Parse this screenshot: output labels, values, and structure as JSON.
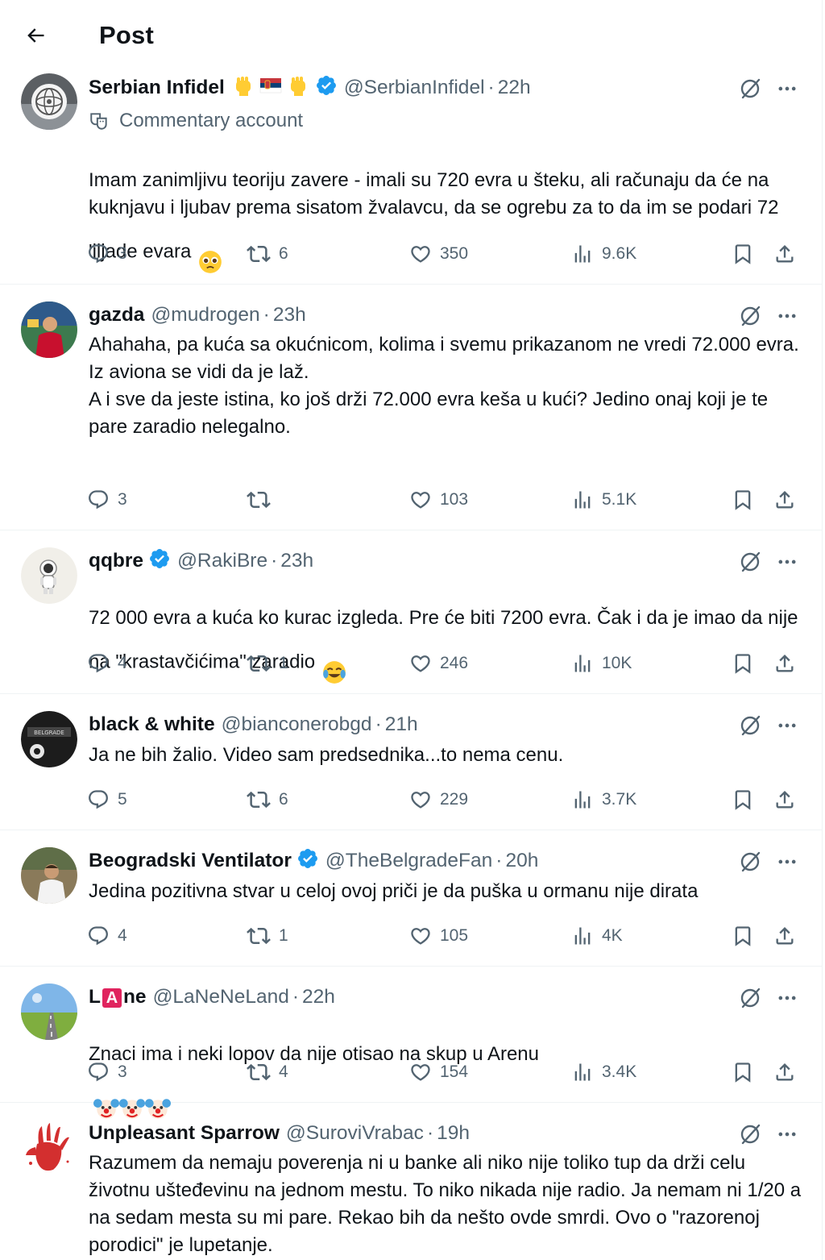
{
  "header": {
    "title": "Post"
  },
  "main": {
    "community_label": "Commentary account",
    "posts": [
      {
        "name": "Serbian Infidel",
        "handle": "@SerbianInfidel",
        "time": "22h",
        "verified": true,
        "name_emojis": [
          "raised-fist-icon",
          "serbia-flag-icon",
          "raised-fist-icon"
        ],
        "text": "Imam zanimljivu teoriju zavere - imali su 720 evra u šteku, ali računaju da će na kuknjavu i ljubav prema sisatom žvalavcu, da se ogrebu za to da im se podari 72 'iljade evara",
        "replies": "3",
        "reposts": "6",
        "likes": "350",
        "views": "9.6K"
      },
      {
        "name": "gazda",
        "handle": "@mudrogen",
        "time": "23h",
        "verified": false,
        "text": "Ahahaha, pa kuća sa okućnicom, kolima i svemu prikazanom ne vredi 72.000 evra.\nIz aviona se vidi da je laž.\nA i sve da jeste istina, ko još drži 72.000 evra keša u kući? Jedino onaj koji je te pare zaradio nelegalno.",
        "replies": "3",
        "reposts": "",
        "likes": "103",
        "views": "5.1K"
      },
      {
        "name": "qqbre",
        "handle": "@RakiBre",
        "time": "23h",
        "verified": true,
        "text": "72 000 evra a kuća ko kurac izgleda. Pre će biti 7200 evra. Čak i da je imao da nije na \"krastavčićima\" zaradio",
        "replies": "4",
        "reposts": "1",
        "likes": "246",
        "views": "10K"
      },
      {
        "name": "black & white",
        "handle": "@bianconerobgd",
        "time": "21h",
        "verified": false,
        "text": "Ja ne bih žalio. Video sam predsednika...to nema cenu.",
        "replies": "5",
        "reposts": "6",
        "likes": "229",
        "views": "3.7K"
      },
      {
        "name": "Beogradski Ventilator",
        "handle": "@TheBelgradeFan",
        "time": "20h",
        "verified": true,
        "text": "Jedina pozitivna stvar u celoj ovoj priči je da puška u ormanu nije dirata",
        "replies": "4",
        "reposts": "1",
        "likes": "105",
        "views": "4K"
      },
      {
        "name_pre": "L",
        "name_box": "A",
        "name_post": "ne",
        "handle": "@LaNeNeLand",
        "time": "22h",
        "verified": false,
        "text": "Znaci ima i neki lopov da nije otisao na skup u Arenu",
        "replies": "3",
        "reposts": "4",
        "likes": "154",
        "views": "3.4K"
      },
      {
        "name": "Unpleasant Sparrow",
        "handle": "@SuroviVrabac",
        "time": "19h",
        "verified": false,
        "text": "Razumem da nemaju poverenja ni u banke ali niko nije toliko tup da drži celu životnu ušteđevinu na jednom mestu. To niko nikada nije radio. Ja nemam ni 1/20 a na sedam mesta su mi pare. Rekao bih da nešto ovde smrdi. Ovo o \"razorenoj porodici\" je lupetanje."
      }
    ]
  }
}
